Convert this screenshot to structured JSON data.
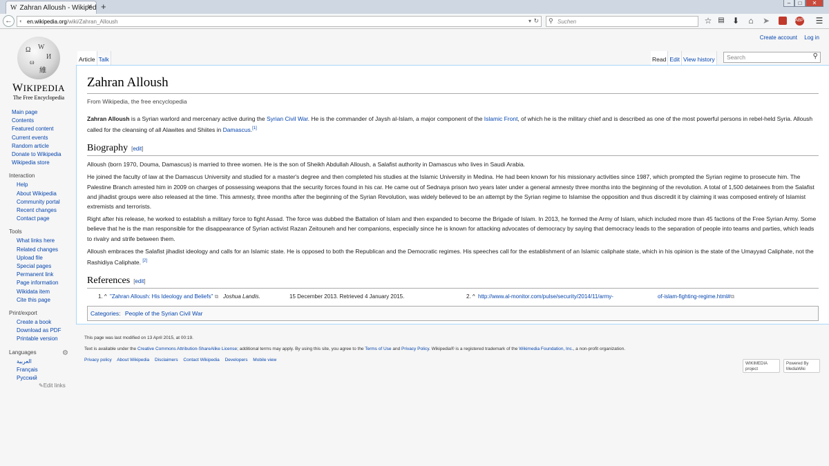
{
  "browser": {
    "tab_title": "Zahran Alloush - Wikipedia...",
    "tab_favicon": "W",
    "url_host": "en.wikipedia.org",
    "url_path": "/wiki/Zahran_Alloush",
    "search_placeholder": "Suchen",
    "adblock_label": "ABP"
  },
  "wiki": {
    "logo_word_initial": "W",
    "logo_word_rest": "IKIPEDIA",
    "logo_tagline": "The Free Encyclopedia",
    "user_links": [
      "Create account",
      "Log in"
    ],
    "tabs_left": [
      "Article",
      "Talk"
    ],
    "tabs_right": [
      "Read",
      "Edit",
      "View history"
    ],
    "search_placeholder": "Search",
    "nav_main": [
      "Main page",
      "Contents",
      "Featured content",
      "Current events",
      "Random article",
      "Donate to Wikipedia",
      "Wikipedia store"
    ],
    "interaction_heading": "Interaction",
    "interaction": [
      "Help",
      "About Wikipedia",
      "Community portal",
      "Recent changes",
      "Contact page"
    ],
    "tools_heading": "Tools",
    "tools": [
      "What links here",
      "Related changes",
      "Upload file",
      "Special pages",
      "Permanent link",
      "Page information",
      "Wikidata item",
      "Cite this page"
    ],
    "print_heading": "Print/export",
    "print": [
      "Create a book",
      "Download as PDF",
      "Printable version"
    ],
    "languages_heading": "Languages",
    "languages": [
      "العربية",
      "Français",
      "Русский"
    ],
    "edit_links": "Edit links"
  },
  "article": {
    "title": "Zahran Alloush",
    "subtitle": "From Wikipedia, the free encyclopedia",
    "intro": {
      "bold": "Zahran Alloush",
      "t1": " is a Syrian warlord and mercenary active during the ",
      "link1": "Syrian Civil War",
      "t2": ". He is the commander of Jaysh al-Islam, a major component of the ",
      "link2": "Islamic Front",
      "t3": ", of which he is the military chief and is described as one of the most powerful persons in rebel-held Syria. Alloush called for the cleansing of all Alawites and Shiites in ",
      "link3": "Damascus",
      "t4": ".",
      "ref": "[1]"
    },
    "section1_heading": "Biography",
    "edit_label": "[edit]",
    "bio_p1": "Alloush (born 1970, Douma, Damascus) is married to three women. He is the son of Sheikh Abdullah Alloush, a Salafist authority in Damascus who lives in Saudi Arabia.",
    "bio_p2": "He joined the faculty of law at the Damascus University and studied for a master's degree and then completed his studies at the Islamic University in Medina. He had been known for his missionary activities since 1987, which prompted the Syrian regime to prosecute him. The Palestine Branch arrested him in 2009 on charges of possessing weapons that the security forces found in his car. He came out of Sednaya prison two years later under a general amnesty three months into the beginning of the revolution. A total of 1,500 detainees from the Salafist and jihadist groups were also released at the time. This amnesty, three months after the beginning of the Syrian Revolution, was widely believed to be an attempt by the Syrian regime to Islamise the opposition and thus discredit it by claiming it was composed entirely of Islamist extremists and terrorists.",
    "bio_p3": "Right after his release, he worked to establish a military force to fight Assad. The force was dubbed the Battalion of Islam and then expanded to become the Brigade of Islam. In 2013, he formed the Army of Islam, which included more than 45 factions of the Free Syrian Army. Some believe that he is the man responsible for the disappearance of Syrian activist Razan Zeitouneh and her companions, especially since he is known for attacking advocates of democracy by saying that democracy leads to the separation of people into teams and parties, which leads to rivalry and strife between them.",
    "bio_p4_text": "Alloush embraces the Salafist jihadist ideology and calls for an Islamic state. He is opposed to both the Republican and the Democratic regimes. His speeches call for the establishment of an Islamic caliphate state, which in his opinion is the state of the Umayyad Caliphate, not the Rashidiya Caliphate. ",
    "bio_p4_ref": "[2]",
    "section2_heading": "References",
    "ref1_num": "1. ^",
    "ref1_link": "\"Zahran Alloush: His Ideology and Beliefs\"",
    "ref1_author": "Joshua Landis.",
    "ref1_date": "15 December 2013. Retrieved 4 January 2015.",
    "ref2_num": "2. ^",
    "ref2_link_a": "http://www.al-monitor.com/pulse/security/2014/11/army-",
    "ref2_link_b": "of-islam-fighting-regime.html#",
    "categories_label": "Categories",
    "category": "People of the Syrian Civil War"
  },
  "footer": {
    "last_modified": "This page was last modified on 13 April 2015, at 00:19.",
    "license_t1": "Text is available under the ",
    "license_link": "Creative Commons Attribution-ShareAlike License",
    "license_t2": "; additional terms may apply. By using this site, you agree to the ",
    "terms_link": "Terms of Use",
    "license_t3": " and ",
    "privacy_link": "Privacy Policy",
    "license_t4": ". Wikipedia® is a registered trademark of the ",
    "foundation_link": "Wikimedia Foundation, Inc.",
    "license_t5": ", a non-profit organization.",
    "places": [
      "Privacy policy",
      "About Wikipedia",
      "Disclaimers",
      "Contact Wikipedia",
      "Developers",
      "Mobile view"
    ],
    "badge1": "WIKIMEDIA project",
    "badge2": "Powered By MediaWiki"
  }
}
